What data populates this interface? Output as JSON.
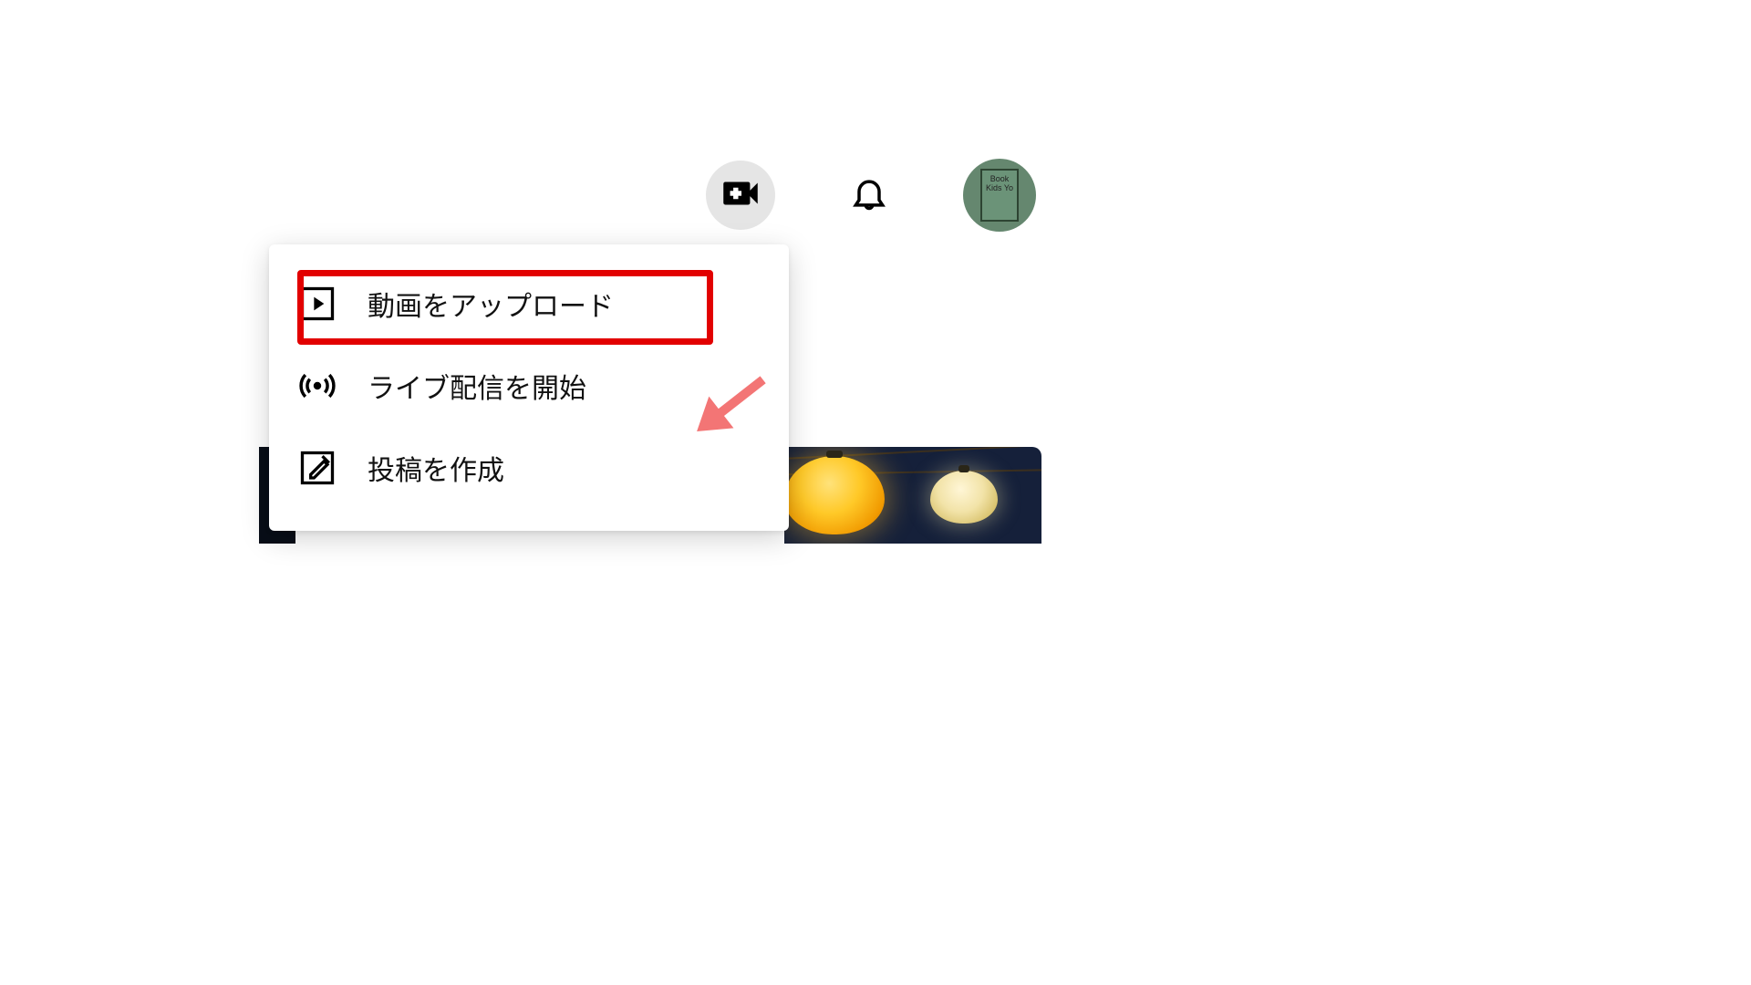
{
  "topbar": {
    "create_button": "create-video",
    "notifications": "notifications",
    "avatar": {
      "line1": "Book",
      "line2": "Kids Yo"
    }
  },
  "menu": {
    "items": [
      {
        "icon": "play-box-icon",
        "label": "動画をアップロード"
      },
      {
        "icon": "broadcast-icon",
        "label": "ライブ配信を開始"
      },
      {
        "icon": "compose-icon",
        "label": "投稿を作成"
      }
    ]
  },
  "annotation": {
    "highlight_target": "menu.items.0",
    "arrow_color": "#f37575"
  }
}
